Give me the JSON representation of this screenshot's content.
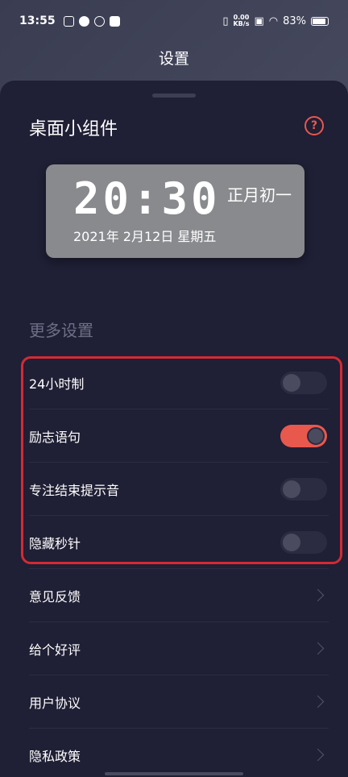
{
  "status_bar": {
    "time": "13:55",
    "net_speed_value": "0.00",
    "net_speed_unit": "KB/s",
    "battery": "83%"
  },
  "header": {
    "title": "设置"
  },
  "widget": {
    "title": "桌面小组件",
    "help": "?",
    "clock": {
      "time": "20:30",
      "lunar": "正月初一",
      "date": "2021年 2月12日 星期五"
    }
  },
  "more_settings": {
    "title": "更多设置",
    "toggles": [
      {
        "label": "24小时制",
        "on": false
      },
      {
        "label": "励志语句",
        "on": true
      },
      {
        "label": "专注结束提示音",
        "on": false
      },
      {
        "label": "隐藏秒针",
        "on": false
      }
    ],
    "links": [
      {
        "label": "意见反馈"
      },
      {
        "label": "给个好评"
      },
      {
        "label": "用户协议"
      },
      {
        "label": "隐私政策"
      }
    ]
  },
  "colors": {
    "accent": "#e9584d",
    "sheet_bg": "#1f1f35",
    "highlight": "#d42a33"
  }
}
